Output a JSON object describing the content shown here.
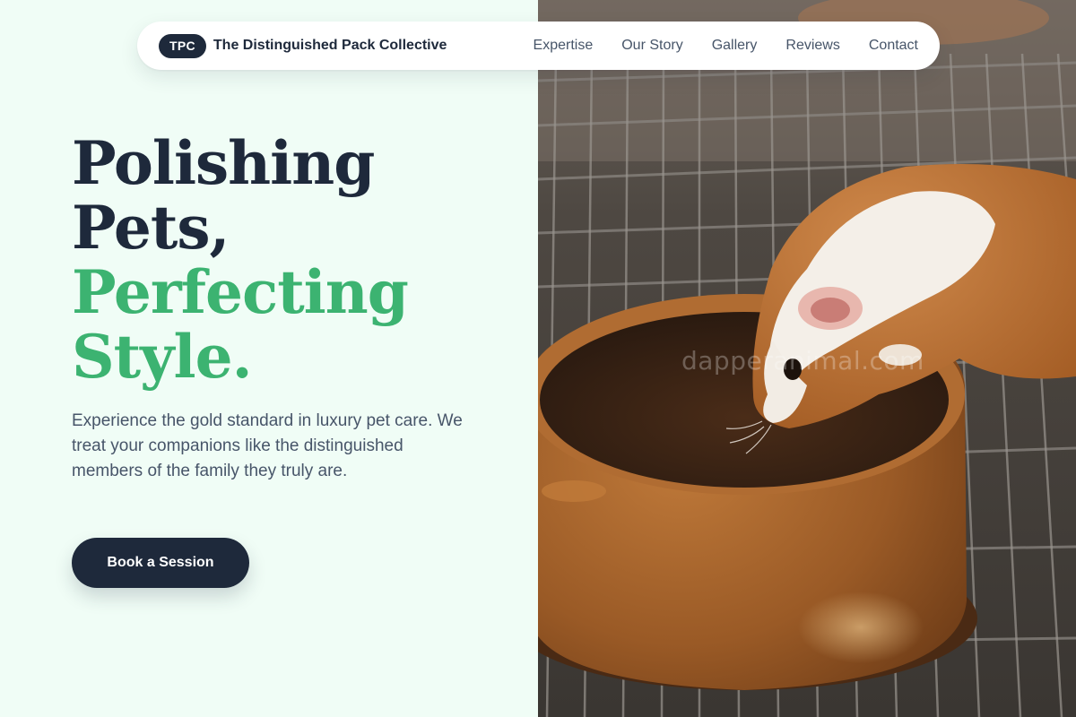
{
  "nav": {
    "badge": "TPC",
    "brand": "The Distinguished Pack Collective",
    "links": [
      "Expertise",
      "Our Story",
      "Gallery",
      "Reviews",
      "Contact"
    ]
  },
  "hero": {
    "title_lines": [
      "Polishing",
      "Pets,"
    ],
    "title_accent_lines": [
      "Perfecting",
      "Style."
    ],
    "description": "Experience the gold standard in luxury pet care. We treat your companions like the distinguished members of the family they truly are.",
    "cta_label": "Book a Session"
  },
  "photo": {
    "subject": "guinea pig drinking from a ceramic water bowl on a wire grate",
    "watermark": "dapperanimal.com"
  },
  "colors": {
    "background": "#f0fdf6",
    "navy": "#1e293b",
    "accent_green": "#3cb371",
    "body_text": "#475569"
  }
}
